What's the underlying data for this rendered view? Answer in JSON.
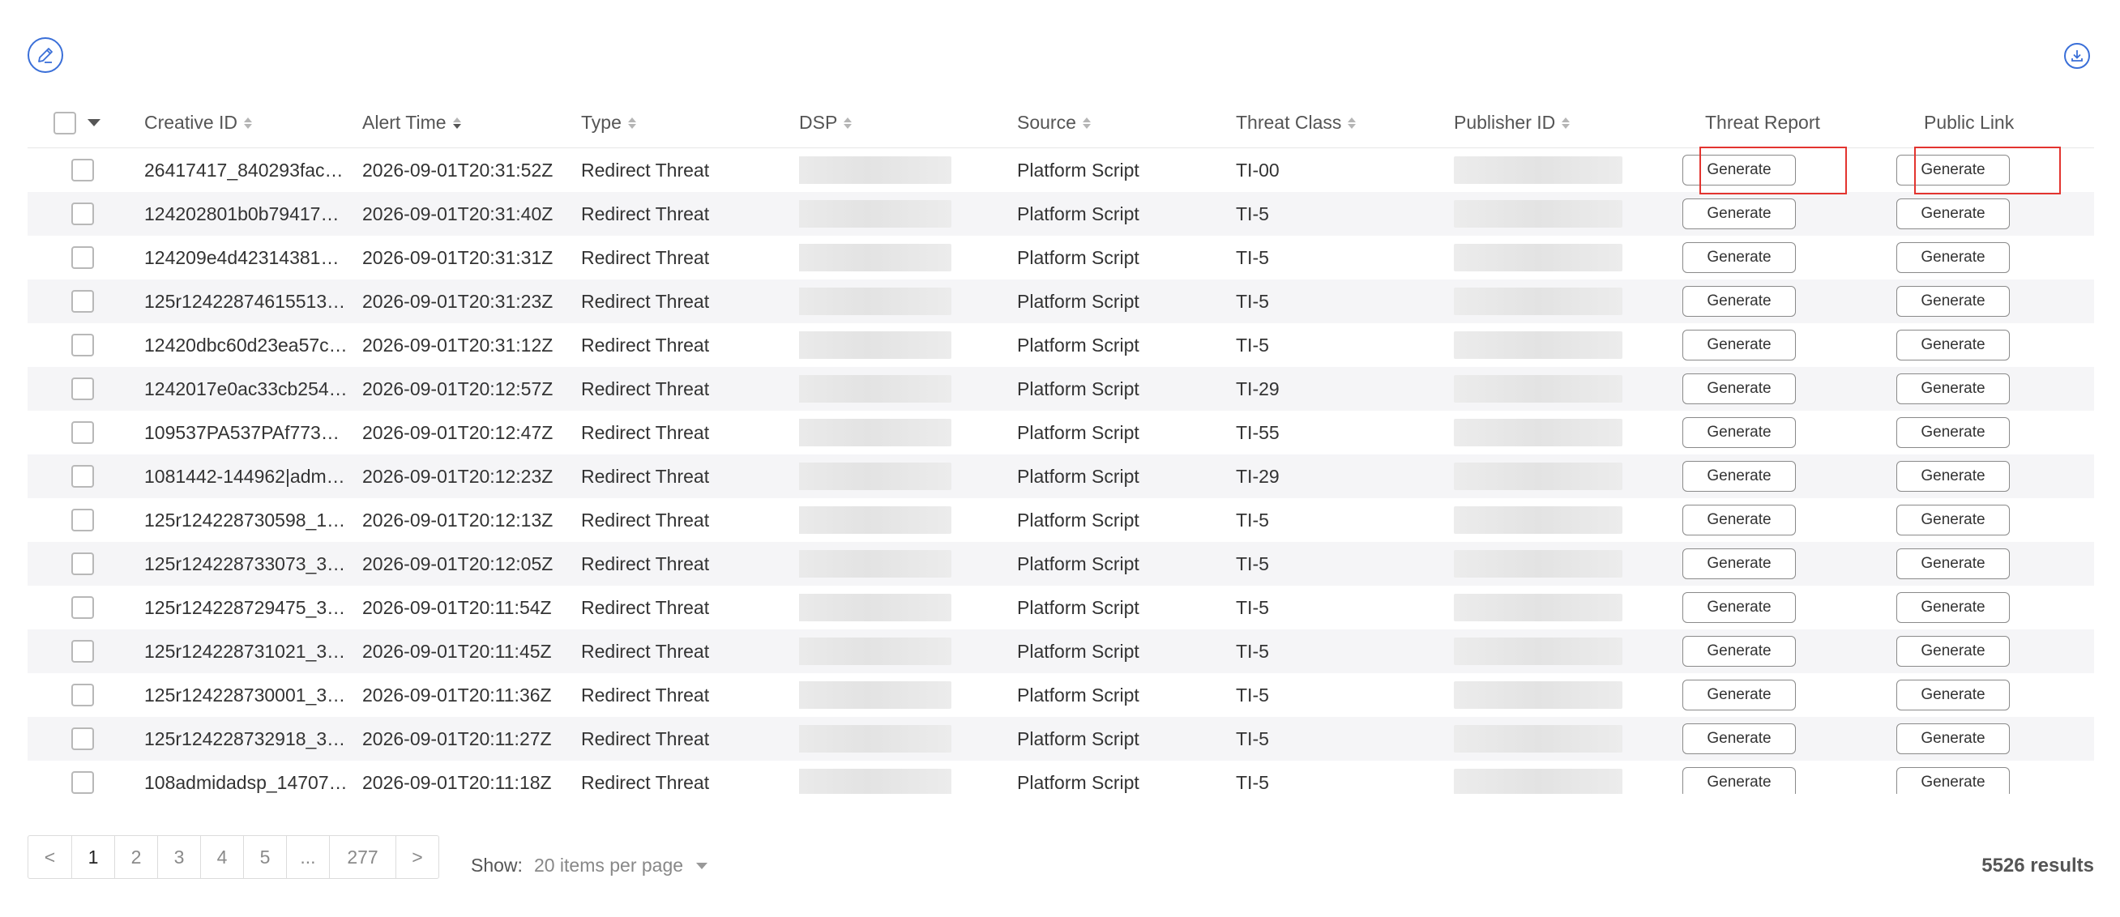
{
  "toolbar": {
    "edit_icon": "pencil-icon",
    "download_icon": "download-icon"
  },
  "table": {
    "columns": [
      {
        "label": "Creative ID",
        "sort": "none"
      },
      {
        "label": "Alert Time",
        "sort": "desc"
      },
      {
        "label": "Type",
        "sort": "none"
      },
      {
        "label": "DSP",
        "sort": "none"
      },
      {
        "label": "Source",
        "sort": "none"
      },
      {
        "label": "Threat Class",
        "sort": "none"
      },
      {
        "label": "Publisher ID",
        "sort": "none"
      },
      {
        "label": "Threat Report",
        "sort": null
      },
      {
        "label": "Public Link",
        "sort": null
      }
    ],
    "button_label": "Generate",
    "rows": [
      {
        "creative_id": "26417417_840293fac…",
        "alert_time": "2026-09-01T20:31:52Z",
        "type": "Redirect Threat",
        "source": "Platform Script",
        "threat_class": "TI-00"
      },
      {
        "creative_id": "124202801b0b79417…",
        "alert_time": "2026-09-01T20:31:40Z",
        "type": "Redirect Threat",
        "source": "Platform Script",
        "threat_class": "TI-5"
      },
      {
        "creative_id": "124209e4d42314381…",
        "alert_time": "2026-09-01T20:31:31Z",
        "type": "Redirect Threat",
        "source": "Platform Script",
        "threat_class": "TI-5"
      },
      {
        "creative_id": "125r12422874615513…",
        "alert_time": "2026-09-01T20:31:23Z",
        "type": "Redirect Threat",
        "source": "Platform Script",
        "threat_class": "TI-5"
      },
      {
        "creative_id": "12420dbc60d23ea57c…",
        "alert_time": "2026-09-01T20:31:12Z",
        "type": "Redirect Threat",
        "source": "Platform Script",
        "threat_class": "TI-5"
      },
      {
        "creative_id": "1242017e0ac33cb254…",
        "alert_time": "2026-09-01T20:12:57Z",
        "type": "Redirect Threat",
        "source": "Platform Script",
        "threat_class": "TI-29"
      },
      {
        "creative_id": "109537PA537PAf773…",
        "alert_time": "2026-09-01T20:12:47Z",
        "type": "Redirect Threat",
        "source": "Platform Script",
        "threat_class": "TI-55"
      },
      {
        "creative_id": "1081442-144962|adm…",
        "alert_time": "2026-09-01T20:12:23Z",
        "type": "Redirect Threat",
        "source": "Platform Script",
        "threat_class": "TI-29"
      },
      {
        "creative_id": "125r124228730598_1…",
        "alert_time": "2026-09-01T20:12:13Z",
        "type": "Redirect Threat",
        "source": "Platform Script",
        "threat_class": "TI-5"
      },
      {
        "creative_id": "125r124228733073_3…",
        "alert_time": "2026-09-01T20:12:05Z",
        "type": "Redirect Threat",
        "source": "Platform Script",
        "threat_class": "TI-5"
      },
      {
        "creative_id": "125r124228729475_3…",
        "alert_time": "2026-09-01T20:11:54Z",
        "type": "Redirect Threat",
        "source": "Platform Script",
        "threat_class": "TI-5"
      },
      {
        "creative_id": "125r124228731021_3…",
        "alert_time": "2026-09-01T20:11:45Z",
        "type": "Redirect Threat",
        "source": "Platform Script",
        "threat_class": "TI-5"
      },
      {
        "creative_id": "125r124228730001_3…",
        "alert_time": "2026-09-01T20:11:36Z",
        "type": "Redirect Threat",
        "source": "Platform Script",
        "threat_class": "TI-5"
      },
      {
        "creative_id": "125r124228732918_3…",
        "alert_time": "2026-09-01T20:11:27Z",
        "type": "Redirect Threat",
        "source": "Platform Script",
        "threat_class": "TI-5"
      },
      {
        "creative_id": "108admidadsp_14707…",
        "alert_time": "2026-09-01T20:11:18Z",
        "type": "Redirect Threat",
        "source": "Platform Script",
        "threat_class": "TI-5"
      }
    ]
  },
  "pagination": {
    "prev": "<",
    "pages": [
      "1",
      "2",
      "3",
      "4",
      "5",
      "...",
      "277"
    ],
    "next": ">",
    "active": "1"
  },
  "show": {
    "label": "Show:",
    "value": "20 items per page"
  },
  "results": "5526 results",
  "colors": {
    "accent": "#3a6fd8",
    "highlight": "#e3342f"
  }
}
